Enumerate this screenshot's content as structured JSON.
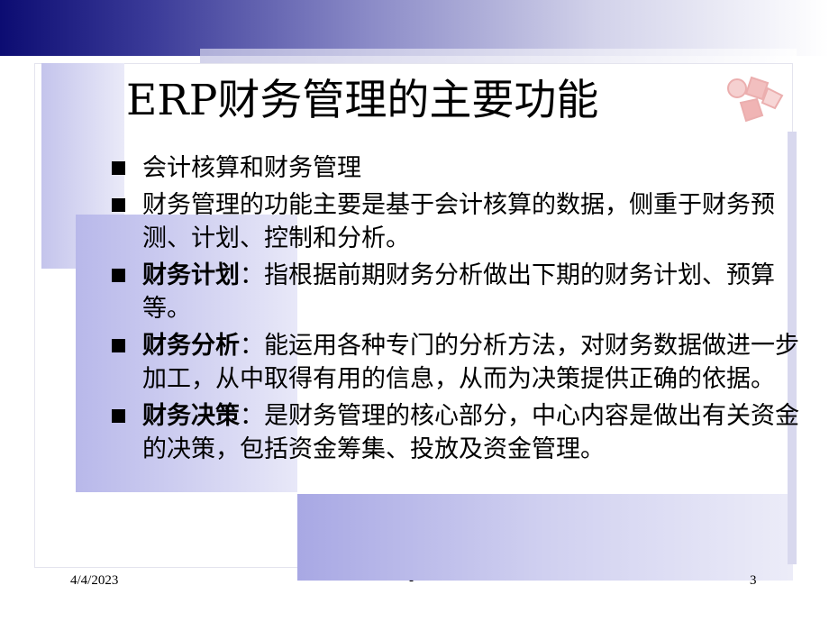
{
  "slide": {
    "title": "ERP财务管理的主要功能",
    "bullets": [
      {
        "lead": "",
        "text": "会计核算和财务管理"
      },
      {
        "lead": "",
        "text": "财务管理的功能主要是基于会计核算的数据，侧重于财务预测、计划、控制和分析。"
      },
      {
        "lead": "财务计划",
        "text": "：指根据前期财务分析做出下期的财务计划、预算等。"
      },
      {
        "lead": "财务分析",
        "text": "：能运用各种专门的分析方法，对财务数据做进一步加工，从中取得有用的信息，从而为决策提供正确的依据。"
      },
      {
        "lead": "财务决策",
        "text": "：是财务管理的核心部分，中心内容是做出有关资金的决策，包括资金筹集、投放及资金管理。"
      }
    ]
  },
  "footer": {
    "date": "4/4/2023",
    "center": "-",
    "page": "3"
  },
  "colors": {
    "band_dark": "#0c0c72",
    "block": "#b8b8ea",
    "logo": "#e07070"
  },
  "icons": {
    "logo": "decorative-cube-logo-icon",
    "bullet": "square-bullet-icon"
  }
}
